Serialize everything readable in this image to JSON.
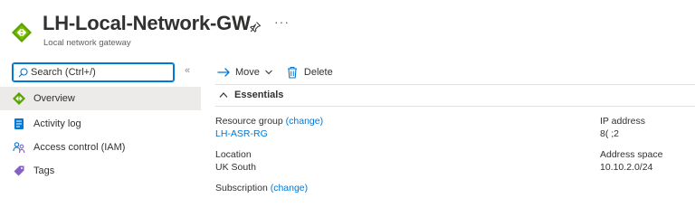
{
  "header": {
    "title": "LH-Local-Network-GW",
    "subtitle": "Local network gateway",
    "more_label": "···"
  },
  "sidebar": {
    "search": {
      "placeholder": "Search (Ctrl+/)",
      "value": ""
    },
    "collapse_label": "«",
    "items": [
      {
        "label": "Overview",
        "icon": "local-network-gateway-icon",
        "active": true
      },
      {
        "label": "Activity log",
        "icon": "activity-log-icon",
        "active": false
      },
      {
        "label": "Access control (IAM)",
        "icon": "people-icon",
        "active": false
      },
      {
        "label": "Tags",
        "icon": "tag-icon",
        "active": false
      }
    ]
  },
  "toolbar": {
    "move_label": "Move",
    "delete_label": "Delete"
  },
  "essentials": {
    "heading": "Essentials",
    "resource_group": {
      "label": "Resource group",
      "change": "(change)",
      "value": "LH-ASR-RG"
    },
    "location": {
      "label": "Location",
      "value": "UK South"
    },
    "subscription": {
      "label": "Subscription",
      "change": "(change)"
    },
    "ip_address": {
      "label": "IP address",
      "value": "8(   ;2"
    },
    "address_space": {
      "label": "Address space",
      "value": "10.10.2.0/24"
    }
  },
  "colors": {
    "accent": "#0078d4",
    "logo_green": "#57a300",
    "active_bg": "#edebe9"
  }
}
